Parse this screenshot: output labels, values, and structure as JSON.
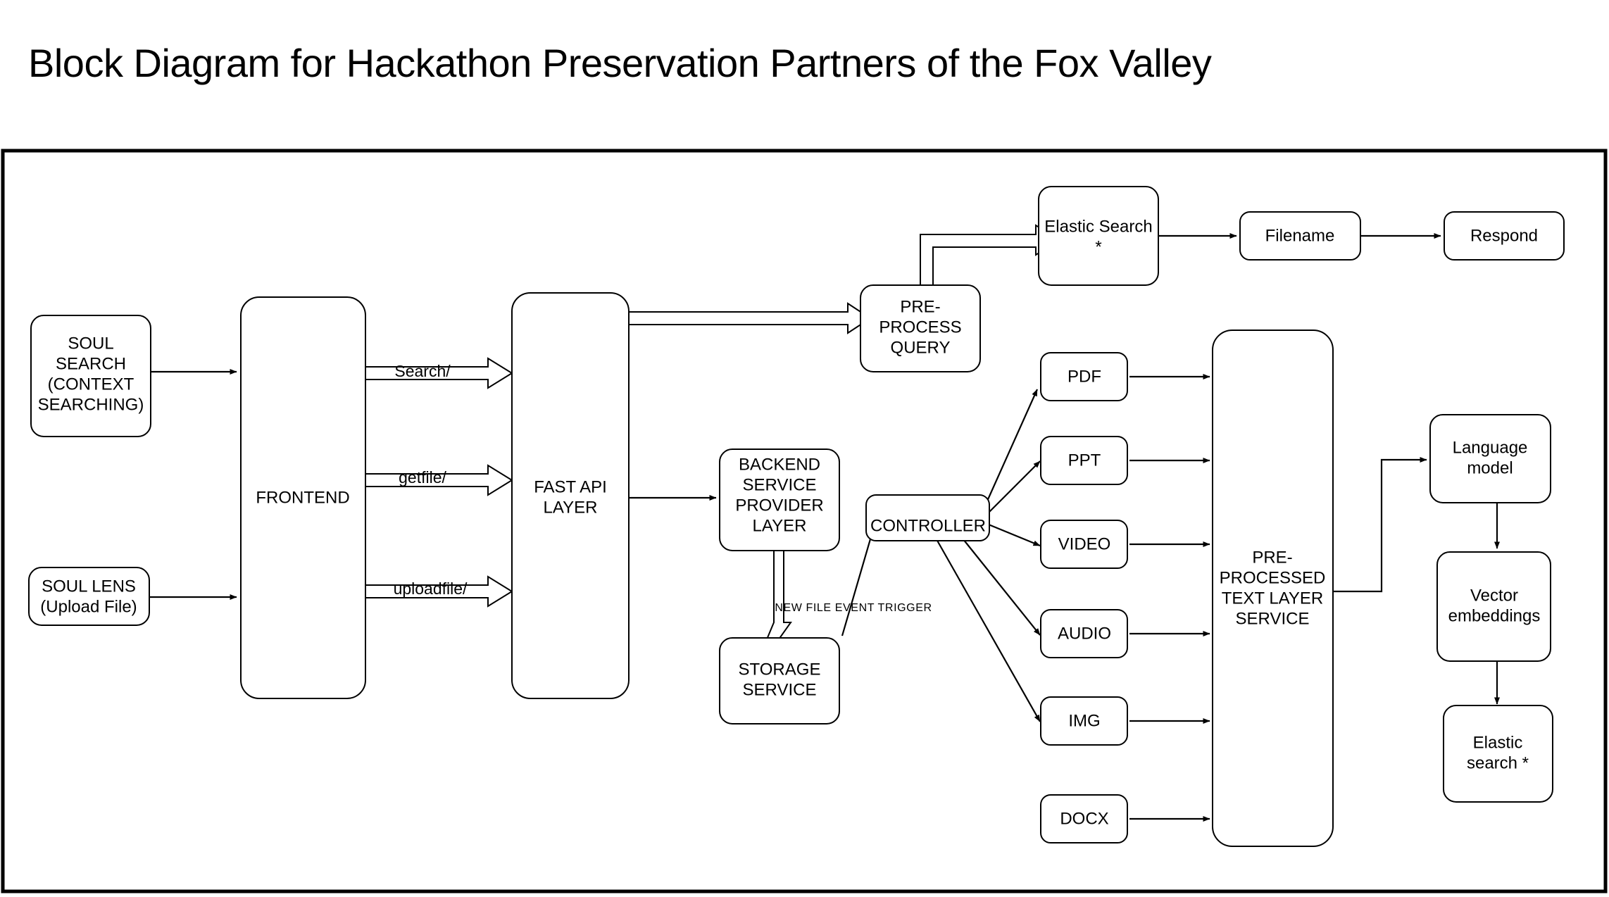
{
  "title": "Block Diagram for Hackathon Preservation Partners of the Fox Valley",
  "nodes": {
    "soul_search": {
      "line1": "SOUL",
      "line2": "SEARCH",
      "line3": "(CONTEXT",
      "line4": "SEARCHING)"
    },
    "soul_lens": {
      "line1": "SOUL LENS",
      "line2": "(Upload File)"
    },
    "frontend": {
      "line1": "FRONTEND"
    },
    "fast_api": {
      "line1": "FAST API",
      "line2": "LAYER"
    },
    "preprocess_query": {
      "line1": "PRE-",
      "line2": "PROCESS",
      "line3": "QUERY"
    },
    "elastic_search_top": {
      "line1": "Elastic Search",
      "line2": "*"
    },
    "filename": {
      "line1": "Filename"
    },
    "respond": {
      "line1": "Respond"
    },
    "backend_service": {
      "line1": "BACKEND",
      "line2": "SERVICE",
      "line3": "PROVIDER",
      "line4": "LAYER"
    },
    "storage_service": {
      "line1": "STORAGE",
      "line2": "SERVICE"
    },
    "controller": {
      "line1": "CONTROLLER"
    },
    "pdf": {
      "line1": "PDF"
    },
    "ppt": {
      "line1": "PPT"
    },
    "video": {
      "line1": "VIDEO"
    },
    "audio": {
      "line1": "AUDIO"
    },
    "img": {
      "line1": "IMG"
    },
    "docx": {
      "line1": "DOCX"
    },
    "preprocessed_text": {
      "line1": "PRE-",
      "line2": "PROCESSED",
      "line3": "TEXT LAYER",
      "line4": "SERVICE"
    },
    "language_model": {
      "line1": "Language",
      "line2": "model"
    },
    "vector_embeddings": {
      "line1": "Vector",
      "line2": "embeddings"
    },
    "elastic_search_bottom": {
      "line1": "Elastic",
      "line2": "search *"
    }
  },
  "edge_labels": {
    "search": "Search/",
    "getfile": "getfile/",
    "uploadfile": "uploadfile/",
    "new_file_event": "NEW FILE EVENT TRIGGER"
  },
  "colors": {
    "stroke": "#000000",
    "fill": "#ffffff",
    "background": "#ffffff"
  }
}
